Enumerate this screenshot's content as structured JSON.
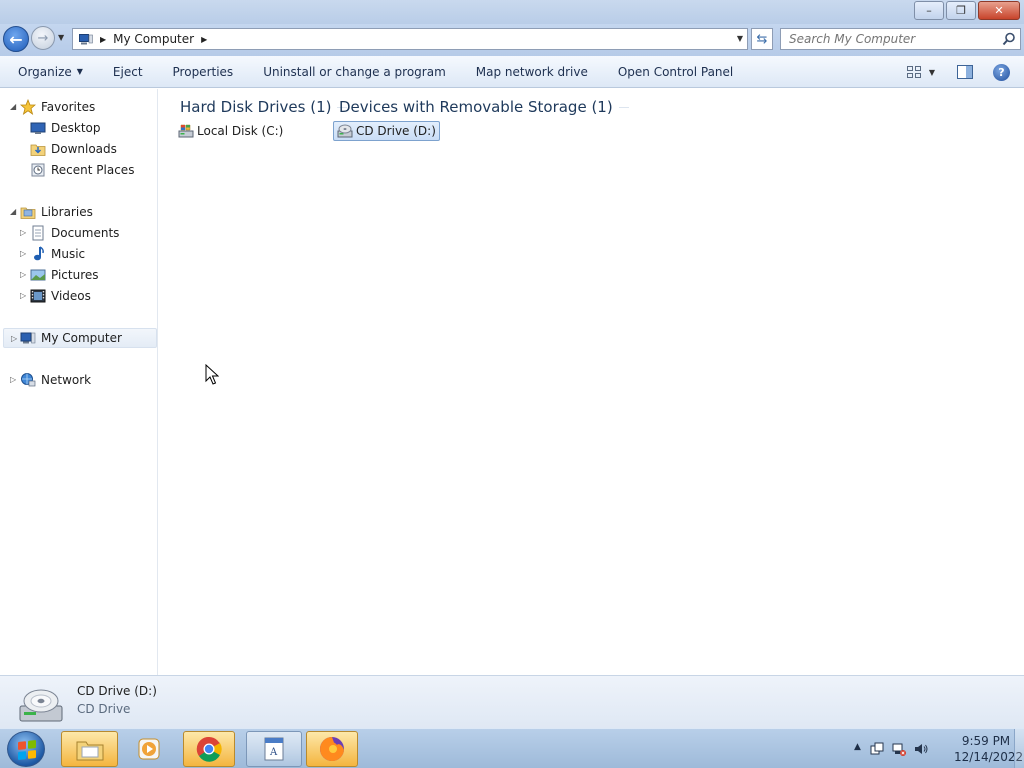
{
  "window": {
    "caption": {
      "minimize": "–",
      "restore": "❐",
      "close": "✕"
    }
  },
  "address": {
    "crumbs": [
      "My Computer"
    ],
    "search_placeholder": "Search My Computer"
  },
  "toolbar": {
    "organize": "Organize",
    "eject": "Eject",
    "properties": "Properties",
    "uninstall": "Uninstall or change a program",
    "map_drive": "Map network drive",
    "control_panel": "Open Control Panel",
    "help": "?"
  },
  "nav": {
    "favorites": "Favorites",
    "desktop": "Desktop",
    "downloads": "Downloads",
    "recent": "Recent Places",
    "libraries": "Libraries",
    "documents": "Documents",
    "music": "Music",
    "pictures": "Pictures",
    "videos": "Videos",
    "computer": "My Computer",
    "network": "Network"
  },
  "content": {
    "groups": [
      {
        "header": "Hard Disk Drives (1)",
        "items": [
          "Local Disk (C:)"
        ]
      },
      {
        "header": "Devices with Removable Storage (1)",
        "items": [
          "CD Drive (D:)"
        ]
      }
    ]
  },
  "details": {
    "name": "CD Drive (D:)",
    "type": "CD Drive"
  },
  "taskbar": {
    "time": "9:59 PM",
    "date": "12/14/2022"
  }
}
